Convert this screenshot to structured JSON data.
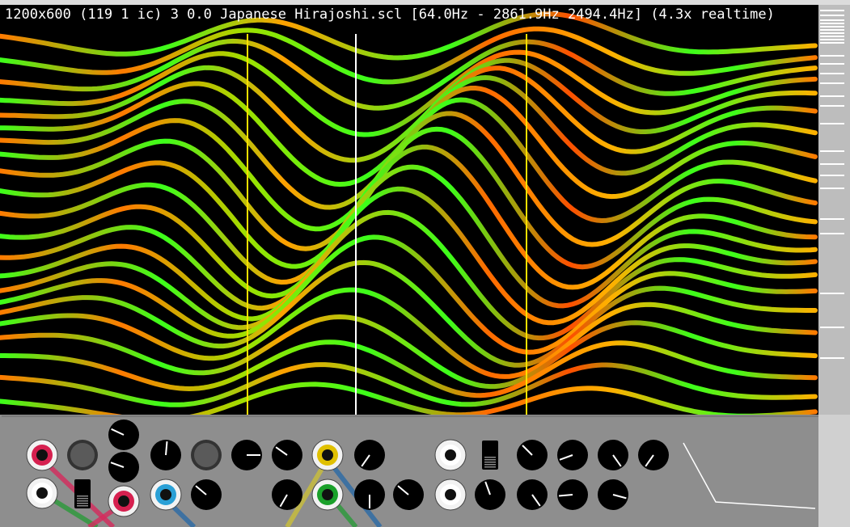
{
  "window": {
    "title_text": "1200x600 (119 1 ic) 3 0.0 Japanese Hirajoshi.scl [64.0Hz - 2861.9Hz 2494.4Hz] (4.3x realtime)"
  },
  "colors": {
    "background": "#000000",
    "curve_primary": "#3cff1a",
    "curve_secondary": "#ff5a00",
    "cursor_yellow": "#ffe000",
    "cursor_white": "#ffffff",
    "panel": "#8e8e8e"
  },
  "icons": {
    "jack": "audio-jack-icon",
    "knob": "knob-icon",
    "switch": "switch-icon",
    "led": "led-indicator-icon"
  }
}
